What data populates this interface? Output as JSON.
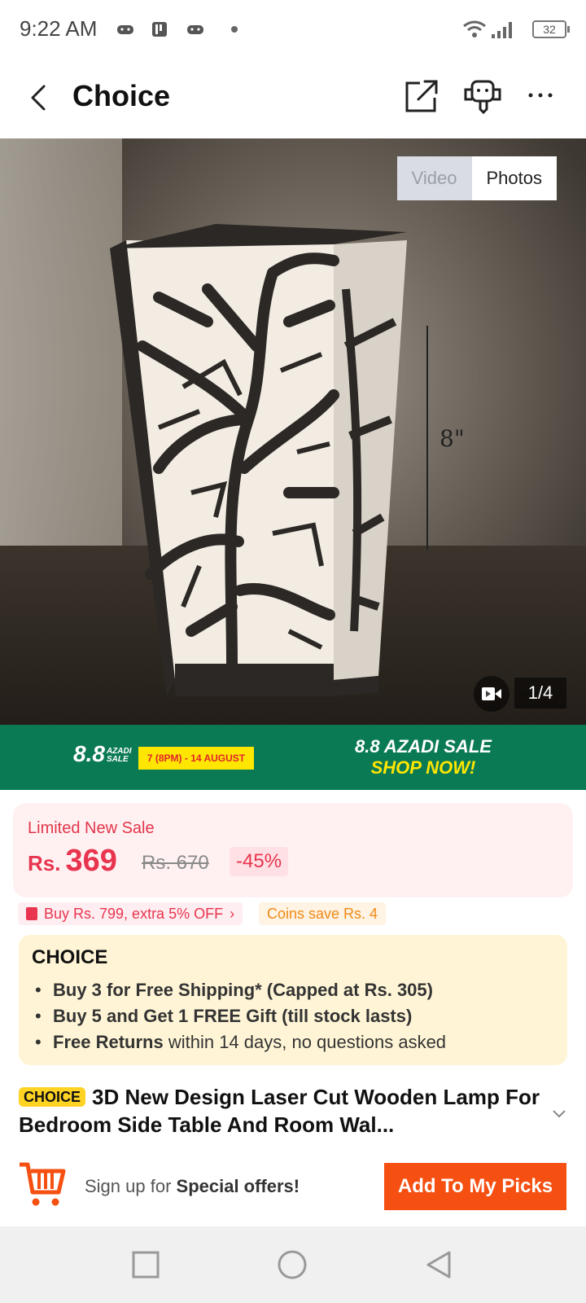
{
  "status_bar": {
    "time": "9:22 AM",
    "battery": "32"
  },
  "header": {
    "title": "Choice"
  },
  "gallery": {
    "tab_video": "Video",
    "tab_photos": "Photos",
    "counter": "1/4",
    "size_label": "8\""
  },
  "banner": {
    "logo": "8.8",
    "logo_sub": "AZADI SALE",
    "dates": "7 (8PM) - 14 AUGUST",
    "line1": "8.8 AZADI SALE",
    "line2": "SHOP NOW!",
    "bg": "#0a7a55",
    "accent": "#ffe600"
  },
  "price": {
    "label": "Limited New Sale",
    "currency": "Rs.",
    "amount": "369",
    "original": "Rs. 670",
    "discount": "-45%",
    "color": "#e8344e"
  },
  "promos": {
    "voucher": "Buy Rs. 799, extra 5% OFF",
    "coins": "Coins save Rs. 4"
  },
  "choice": {
    "logo": "CHOICE",
    "b1": "Buy 3 for  Free Shipping* (Capped at Rs. 305)",
    "b2": "Buy 5 and Get 1 FREE Gift (till stock lasts)",
    "b3_bold": "Free Returns",
    "b3_rest": " within 14 days, no questions asked"
  },
  "product": {
    "tag": "CHOICE",
    "title": "3D New Design Laser Cut Wooden Lamp For Bedroom Side Table And Room Wal..."
  },
  "action_bar": {
    "signup_prefix": "Sign up for ",
    "signup_bold": "Special offers!",
    "add_button": "Add To My Picks",
    "button_color": "#f54f11"
  }
}
